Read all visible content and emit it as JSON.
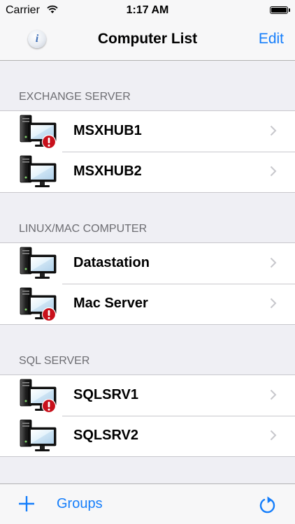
{
  "status_bar": {
    "carrier": "Carrier",
    "time": "1:17 AM"
  },
  "nav": {
    "info_icon_glyph": "i",
    "title": "Computer List",
    "edit_label": "Edit"
  },
  "sections": [
    {
      "header": "EXCHANGE SERVER",
      "items": [
        {
          "label": "MSXHUB1",
          "alert": true
        },
        {
          "label": "MSXHUB2",
          "alert": false
        }
      ]
    },
    {
      "header": "LINUX/MAC COMPUTER",
      "items": [
        {
          "label": "Datastation",
          "alert": false
        },
        {
          "label": "Mac Server",
          "alert": true
        }
      ]
    },
    {
      "header": "SQL SERVER",
      "items": [
        {
          "label": "SQLSRV1",
          "alert": true
        },
        {
          "label": "SQLSRV2",
          "alert": false
        }
      ]
    }
  ],
  "toolbar": {
    "add_icon": "plus-icon",
    "groups_label": "Groups",
    "refresh_icon": "refresh-icon"
  },
  "colors": {
    "accent": "#157efb",
    "background": "#efeff4",
    "alert": "#d0121b"
  }
}
